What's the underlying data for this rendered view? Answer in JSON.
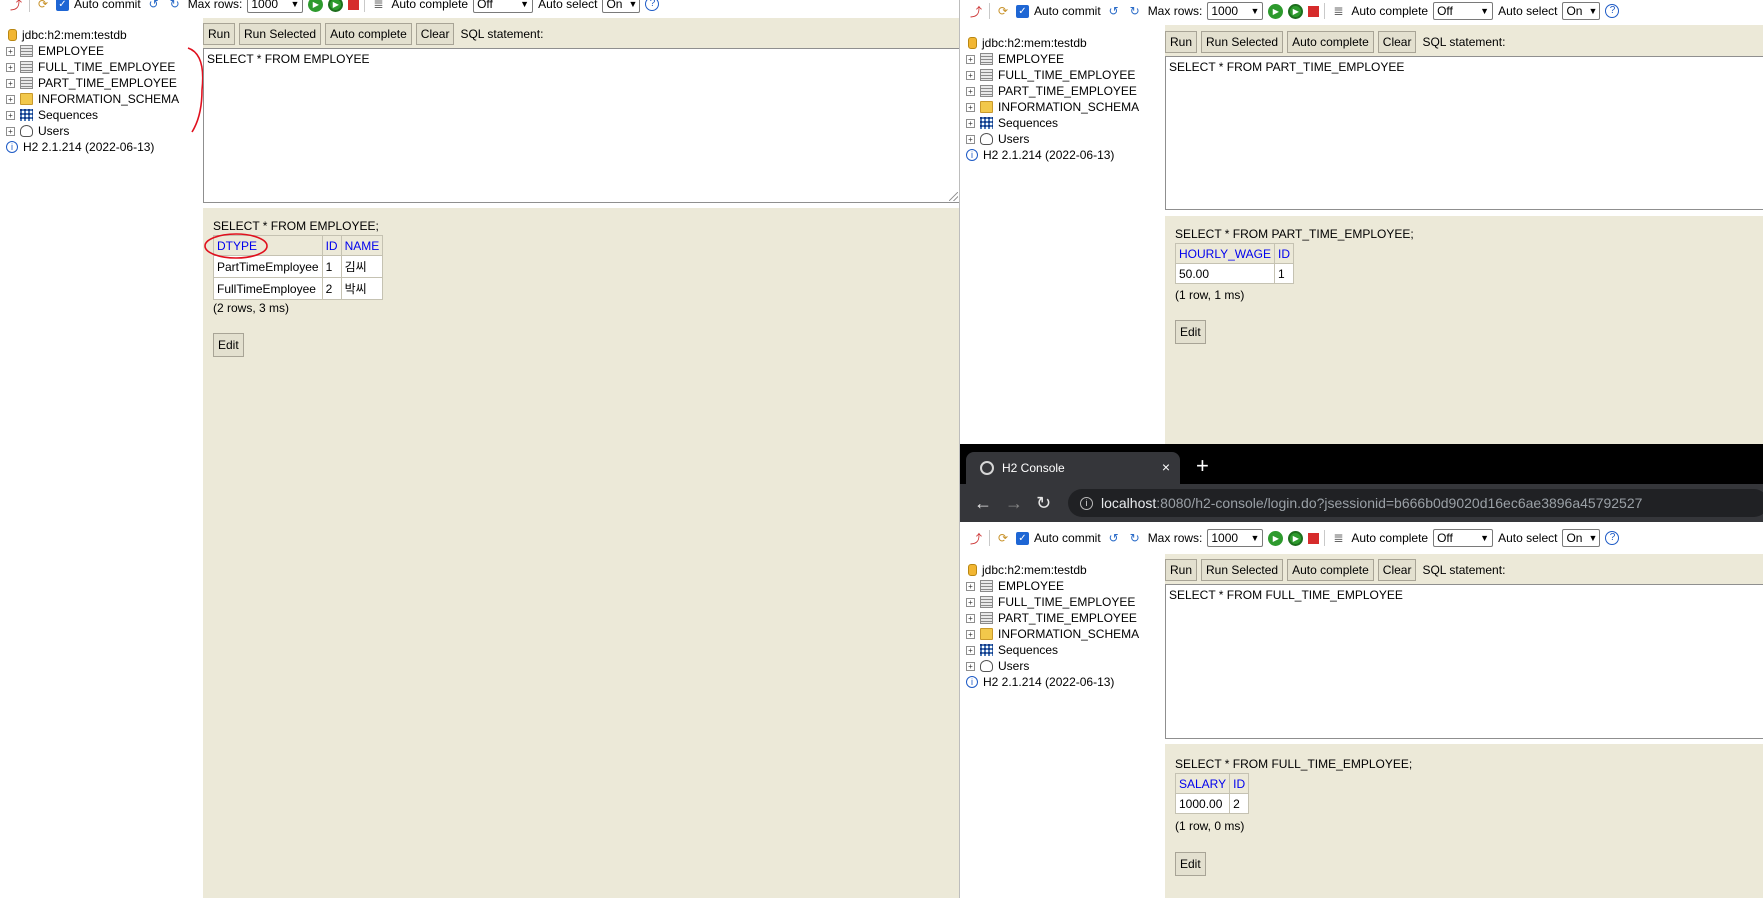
{
  "toolbar": {
    "auto_commit_label": "Auto commit",
    "auto_commit_checked": true,
    "max_rows_label": "Max rows:",
    "max_rows_value": "1000",
    "auto_complete_label": "Auto complete",
    "auto_complete_value": "Off",
    "auto_select_label": "Auto select",
    "auto_select_value": "On",
    "help_glyph": "?"
  },
  "tree": {
    "connection": "jdbc:h2:mem:testdb",
    "items": [
      {
        "label": "EMPLOYEE",
        "icon": "table-icon"
      },
      {
        "label": "FULL_TIME_EMPLOYEE",
        "icon": "table-icon"
      },
      {
        "label": "PART_TIME_EMPLOYEE",
        "icon": "table-icon"
      },
      {
        "label": "INFORMATION_SCHEMA",
        "icon": "folder-icon"
      },
      {
        "label": "Sequences",
        "icon": "sequences-icon"
      },
      {
        "label": "Users",
        "icon": "users-icon"
      }
    ],
    "version": "H2 2.1.214 (2022-06-13)"
  },
  "buttons": {
    "run": "Run",
    "run_selected": "Run Selected",
    "auto_complete": "Auto complete",
    "clear": "Clear",
    "sql_statement": "SQL statement:",
    "edit": "Edit"
  },
  "windows": {
    "left": {
      "sql": "SELECT * FROM EMPLOYEE",
      "result_statement": "SELECT * FROM EMPLOYEE;",
      "columns": [
        "DTYPE",
        "ID",
        "NAME"
      ],
      "rows": [
        [
          "PartTimeEmployee",
          "1",
          "김씨"
        ],
        [
          "FullTimeEmployee",
          "2",
          "박씨"
        ]
      ],
      "row_count": "(2 rows, 3 ms)"
    },
    "top_right": {
      "sql": "SELECT * FROM PART_TIME_EMPLOYEE",
      "result_statement": "SELECT * FROM PART_TIME_EMPLOYEE;",
      "columns": [
        "HOURLY_WAGE",
        "ID"
      ],
      "rows": [
        [
          "50.00",
          "1"
        ]
      ],
      "row_count": "(1 row, 1 ms)"
    },
    "bottom_right": {
      "browser": {
        "tab_title": "H2 Console",
        "close_glyph": "×",
        "new_tab_glyph": "+",
        "url_host": "localhost",
        "url_rest": ":8080/h2-console/login.do?jsessionid=b666b0d9020d16ec6ae3896a45792527"
      },
      "sql": "SELECT * FROM FULL_TIME_EMPLOYEE",
      "result_statement": "SELECT * FROM FULL_TIME_EMPLOYEE;",
      "columns": [
        "SALARY",
        "ID"
      ],
      "rows": [
        [
          "1000.00",
          "2"
        ]
      ],
      "row_count": "(1 row, 0 ms)"
    }
  },
  "colors": {
    "panel_bg": "#ece9d8",
    "link_blue": "#0000ee",
    "annotation_red": "#e0101e"
  }
}
